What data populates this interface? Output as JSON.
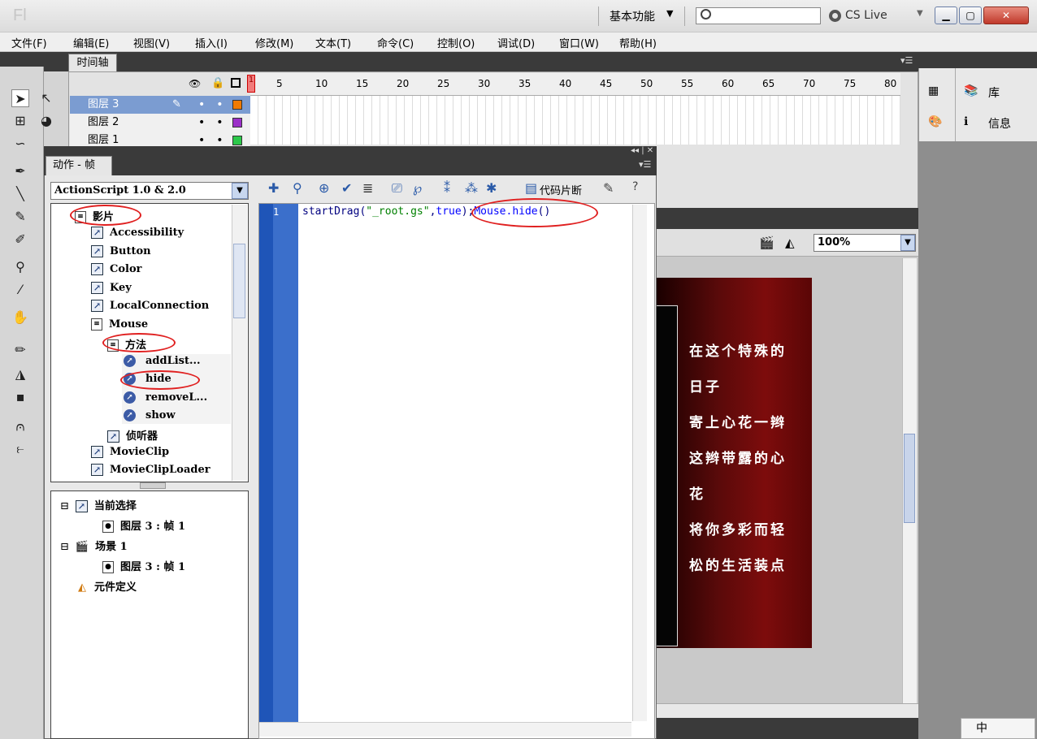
{
  "app": {
    "logo": "Fl",
    "workspace": "基本功能",
    "cs_live": "CS Live"
  },
  "window": {
    "minimize": "▁",
    "maximize": "▢",
    "close": "✕"
  },
  "menu": [
    "文件(F)",
    "编辑(E)",
    "视图(V)",
    "插入(I)",
    "修改(M)",
    "文本(T)",
    "命令(C)",
    "控制(O)",
    "调试(D)",
    "窗口(W)",
    "帮助(H)"
  ],
  "timeline": {
    "tab": "时间轴",
    "ruler": [
      "1",
      "5",
      "10",
      "15",
      "20",
      "25",
      "30",
      "35",
      "40",
      "45",
      "50",
      "55",
      "60",
      "65",
      "70",
      "75",
      "80"
    ],
    "layers": [
      {
        "name": "图层 3",
        "color": "#f07a00"
      },
      {
        "name": "图层 2",
        "color": "#9b30c8"
      },
      {
        "name": "图层 1",
        "color": "#2cc84a"
      }
    ]
  },
  "right_panel": {
    "library": "库",
    "info": "信息"
  },
  "actions_panel": {
    "tab": "动作 - 帧",
    "language": "ActionScript 1.0 & 2.0",
    "snippet_button": "代码片断",
    "tree": {
      "movie": "影片",
      "items": [
        "Accessibility",
        "Button",
        "Color",
        "Key",
        "LocalConnection",
        "Mouse"
      ],
      "methods": "方法",
      "method_items": [
        "addList...",
        "hide",
        "removeL...",
        "show"
      ],
      "listeners": "侦听器",
      "more": [
        "MovieClip",
        "MovieClipLoader"
      ]
    },
    "scope": {
      "current_selection": "当前选择",
      "cs_frame": "图层 3 : 帧 1",
      "scene": "场景 1",
      "scene_frame": "图层 3 : 帧 1",
      "symbols": "元件定义"
    },
    "code": {
      "line_number": "1",
      "part1": "startDrag(",
      "string": "\"_root.gs\"",
      "part2": ",",
      "keyword": "true",
      "part3": ");",
      "call": "Mouse.hide",
      "part4": "()"
    }
  },
  "stage": {
    "zoom": "100%",
    "poem": [
      "在这个特殊的",
      "日子",
      "寄上心花一辫",
      "这辫带露的心",
      "花",
      "将你多彩而轻",
      "松的生活装点"
    ]
  },
  "ime": "中"
}
